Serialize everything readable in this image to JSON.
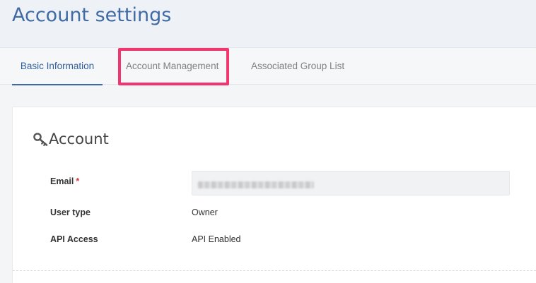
{
  "page": {
    "title": "Account settings"
  },
  "tabs": [
    {
      "label": "Basic Information",
      "active": true
    },
    {
      "label": "Account Management",
      "active": false,
      "highlighted": true
    },
    {
      "label": "Associated Group List",
      "active": false
    }
  ],
  "account_section": {
    "title": "Account",
    "icon": "key-icon",
    "fields": {
      "email": {
        "label": "Email",
        "required_marker": "*",
        "value": ""
      },
      "user_type": {
        "label": "User type",
        "value": "Owner"
      },
      "api_access": {
        "label": "API Access",
        "value": "API Enabled"
      }
    }
  },
  "colors": {
    "accent": "#3f6aa4",
    "highlight": "#f2356e",
    "required": "#d9323a"
  }
}
